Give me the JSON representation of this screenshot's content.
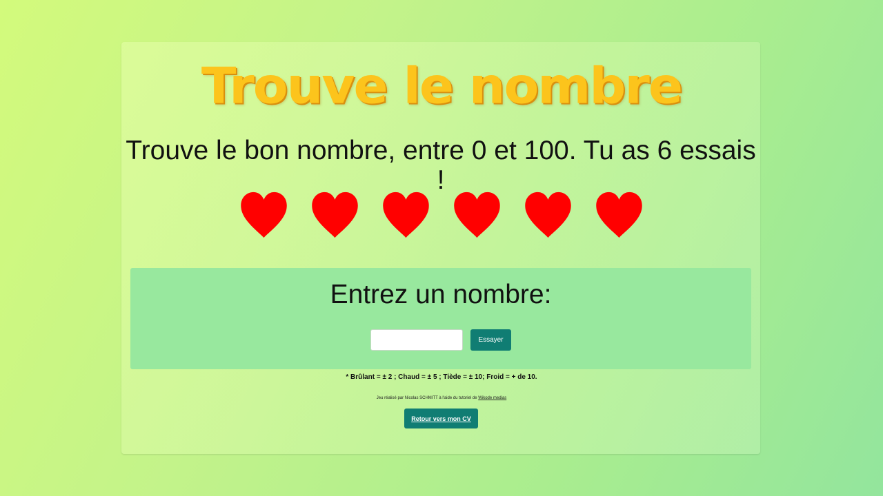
{
  "header": {
    "title": "Trouve le nombre",
    "instructions": "Trouve le bon nombre, entre 0 et 100. Tu as 6 essais !"
  },
  "lives": {
    "count": 6,
    "icon": "heart-icon",
    "color": "#ff0000"
  },
  "entry": {
    "label": "Entrez un nombre:",
    "input_value": "",
    "button_label": "Essayer"
  },
  "hint": "* Brûlant = ± 2 ; Chaud = ± 5 ; Tiède = ± 10; Froid = + de 10.",
  "credit": {
    "text": "Jeu réalisé par Nicolas SCHMITT à l'aide du tutoriel de ",
    "link_text": "Wikode medias"
  },
  "cv_button_label": "Retour vers mon CV",
  "colors": {
    "title": "#fcc41c",
    "button": "#107d73",
    "entry_panel": "#98e89e"
  }
}
